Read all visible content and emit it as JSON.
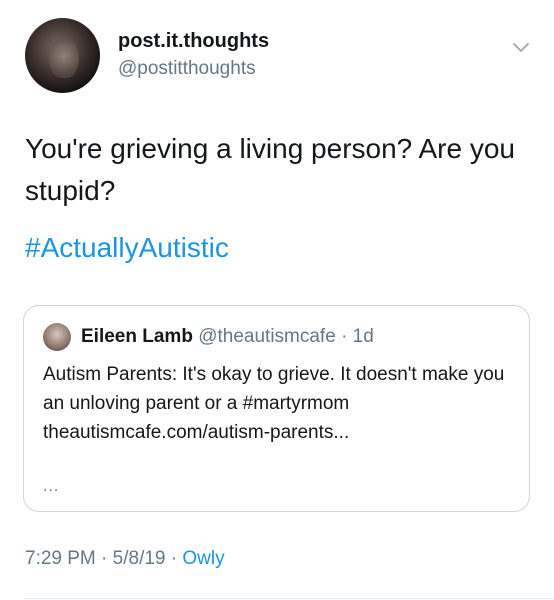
{
  "author": {
    "display_name": "post.it.thoughts",
    "handle": "@postitthoughts"
  },
  "tweet": {
    "text": "You're grieving a living person?  Are you stupid?",
    "hashtag": "#ActuallyAutistic",
    "time": "7:29 PM",
    "date": "5/8/19",
    "source": "Owly",
    "separator": "·"
  },
  "quoted_tweet": {
    "display_name": "Eileen Lamb",
    "handle": "@theautismcafe",
    "age": "1d",
    "separator": "·",
    "text": "Autism Parents: It's okay to grieve. It doesn't make you an unloving parent or a #martyrmom theautismcafe.com/autism-parents...",
    "ellipsis": "..."
  },
  "icons": {
    "menu": "chevron-down-icon"
  },
  "colors": {
    "link": "#1b95e0",
    "secondary_text": "#657786",
    "border": "#ccd6dd"
  }
}
